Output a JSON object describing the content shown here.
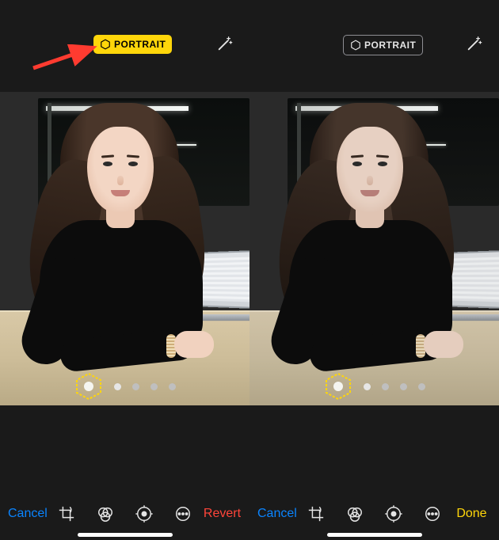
{
  "colors": {
    "accent": "#ffd60a",
    "blue": "#0a84ff",
    "red": "#ff453a",
    "bg": "#1a1a1a"
  },
  "left": {
    "badge": {
      "label": "PORTRAIT",
      "active": true,
      "icon": "portrait-hex-icon"
    },
    "wand_icon": "magic-wand-icon",
    "lighting": {
      "selected_index": 0,
      "dot_count": 4,
      "selector_icon": "lighting-hex-icon"
    },
    "toolbar": {
      "cancel": "Cancel",
      "crop_icon": "crop-icon",
      "filters_icon": "filters-icon",
      "adjust_icon": "adjust-icon",
      "more_icon": "more-icon",
      "revert": "Revert"
    }
  },
  "right": {
    "badge": {
      "label": "PORTRAIT",
      "active": false,
      "icon": "portrait-hex-icon"
    },
    "wand_icon": "magic-wand-icon",
    "lighting": {
      "selected_index": 0,
      "dot_count": 4,
      "selector_icon": "lighting-hex-icon"
    },
    "toolbar": {
      "cancel": "Cancel",
      "crop_icon": "crop-icon",
      "filters_icon": "filters-icon",
      "adjust_icon": "adjust-icon",
      "more_icon": "more-icon",
      "done": "Done"
    }
  },
  "annotation": {
    "arrow_points_to": "left.badge"
  }
}
